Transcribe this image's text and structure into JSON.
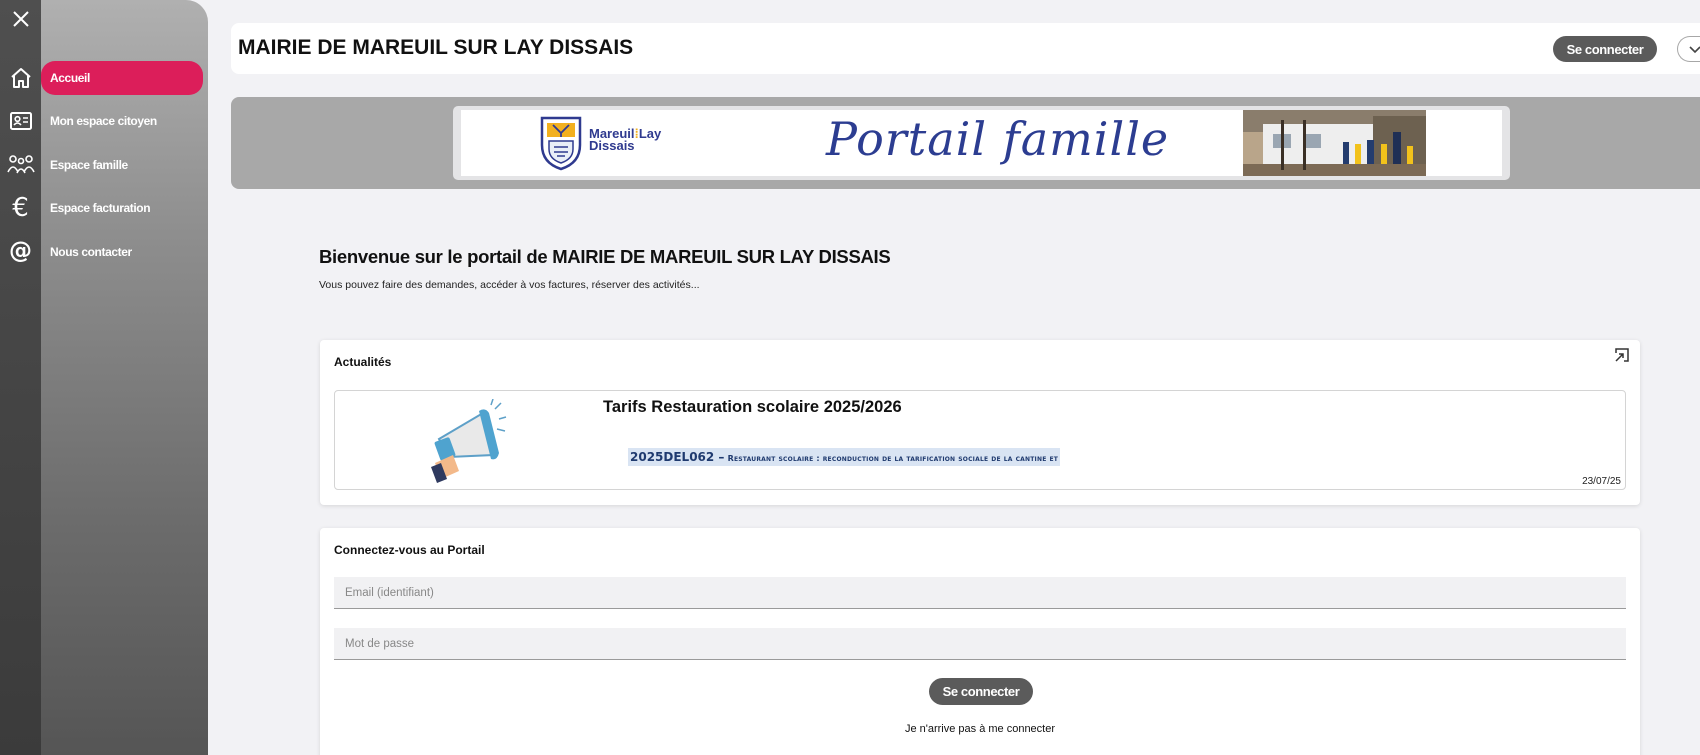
{
  "header": {
    "title": "MAIRIE DE MAREUIL SUR LAY DISSAIS",
    "login_label": "Se connecter"
  },
  "sidebar": {
    "items": [
      {
        "label": "Accueil",
        "icon": "home-icon",
        "active": true
      },
      {
        "label": "Mon espace citoyen",
        "icon": "id-card-icon",
        "active": false
      },
      {
        "label": "Espace famille",
        "icon": "family-icon",
        "active": false
      },
      {
        "label": "Espace facturation",
        "icon": "euro-icon",
        "active": false
      },
      {
        "label": "Nous contacter",
        "icon": "at-icon",
        "active": false
      }
    ],
    "close_icon": "close-icon"
  },
  "banner": {
    "town_line1": "Mareuil",
    "town_line1_suffix": "Lay",
    "town_line2": "Dissais",
    "portal_title": "Portail famille"
  },
  "welcome": {
    "title": "Bienvenue sur le portail de MAIRIE DE MAREUIL SUR LAY DISSAIS",
    "subtitle": "Vous pouvez faire des demandes, accéder à vos factures, réserver des activités..."
  },
  "news": {
    "heading": "Actualités",
    "items": [
      {
        "title": "Tarifs Restauration scolaire 2025/2026",
        "excerpt_lead": "2025DEL062 –",
        "excerpt_rest": "Restaurant scolaire : reconduction de la tarification sociale de la cantine et",
        "date": "23/07/25"
      }
    ]
  },
  "login": {
    "heading": "Connectez-vous au Portail",
    "email_placeholder": "Email (identifiant)",
    "password_placeholder": "Mot de passe",
    "submit_label": "Se connecter",
    "help_link": "Je n'arrive pas à me connecter"
  },
  "colors": {
    "accent": "#dc1e5a",
    "button": "#5b5b5b",
    "title_blue": "#2c3d91"
  }
}
